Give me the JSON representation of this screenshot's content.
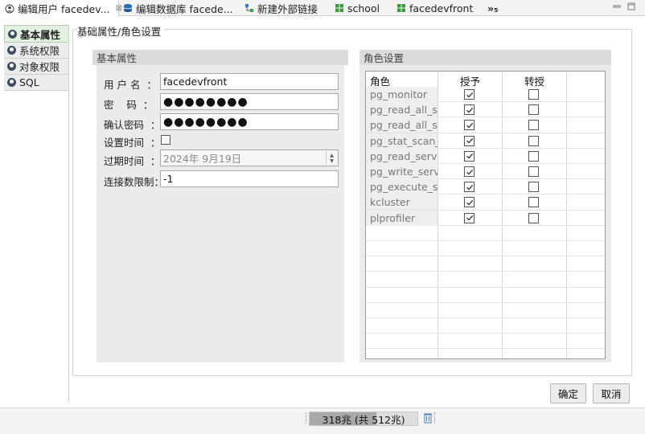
{
  "tabs": [
    {
      "label": "编辑用户 facedev...",
      "icon": "user-edit-icon",
      "active": true,
      "closable": true
    },
    {
      "label": "编辑数据库 facede...",
      "icon": "database-icon",
      "active": false
    },
    {
      "label": "新建外部链接",
      "icon": "link-icon",
      "active": false
    },
    {
      "label": "school",
      "icon": "schema-icon",
      "active": false
    },
    {
      "label": "facedevfront",
      "icon": "schema-icon",
      "active": false
    },
    {
      "label": "»₅",
      "icon": "more-tabs-icon",
      "active": false
    }
  ],
  "window_controls": {
    "minimize": "▭",
    "maximize": "▯"
  },
  "sidebar": {
    "items": [
      {
        "label": "基本属性",
        "active": true
      },
      {
        "label": "系统权限",
        "active": false
      },
      {
        "label": "对象权限",
        "active": false
      },
      {
        "label": "SQL",
        "active": false
      }
    ]
  },
  "group_title": "基础属性/角色设置",
  "basic": {
    "title": "基本属性",
    "username_label": "用 户 名  ：",
    "username_value": "facedevfront",
    "password_label": "密    码  ：",
    "password_value": "●●●●●●●●",
    "confirm_label": "确认密码  ：",
    "confirm_value": "●●●●●●●●",
    "settime_label": "设置时间  ：",
    "settime_checked": false,
    "expire_label": "过期时间  ：",
    "expire_value": "2024年  9月19日",
    "connlimit_label": "连接数限制：",
    "connlimit_value": "-1"
  },
  "roles": {
    "title": "角色设置",
    "columns": {
      "role": "角色",
      "grant": "授予",
      "transfer": "转授"
    },
    "rows": [
      {
        "name": "pg_monitor",
        "grant": true,
        "transfer": false
      },
      {
        "name": "pg_read_all_se",
        "grant": true,
        "transfer": false
      },
      {
        "name": "pg_read_all_sta",
        "grant": true,
        "transfer": false
      },
      {
        "name": "pg_stat_scan_t",
        "grant": true,
        "transfer": false
      },
      {
        "name": "pg_read_serve",
        "grant": true,
        "transfer": false
      },
      {
        "name": "pg_write_serve",
        "grant": true,
        "transfer": false
      },
      {
        "name": "pg_execute_se",
        "grant": true,
        "transfer": false
      },
      {
        "name": "kcluster",
        "grant": true,
        "transfer": false
      },
      {
        "name": "plprofiler",
        "grant": true,
        "transfer": false
      }
    ]
  },
  "buttons": {
    "ok": "确定",
    "cancel": "取消"
  },
  "status": {
    "heap_text": "318兆 (共 512兆)",
    "heap_used_mb": 318,
    "heap_total_mb": 512
  }
}
